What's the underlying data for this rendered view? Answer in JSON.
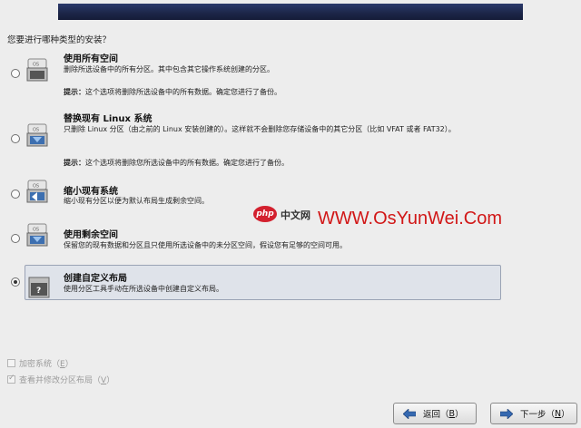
{
  "question": "您要进行哪种类型的安装？",
  "options": [
    {
      "title": "使用所有空间",
      "desc": "删除所选设备中的所有分区。其中包含其它操作系统创建的分区。",
      "note_label": "提示：",
      "note": "这个选项将删除所选设备中的所有数据。确定您进行了备份。",
      "icon": "disk-erase-icon",
      "selected": false
    },
    {
      "title": "替换现有 Linux 系统",
      "desc": "只删除 Linux 分区（由之前的 Linux 安装创建的）。这样就不会删除您存储设备中的其它分区（比如 VFAT 或者 FAT32）。",
      "note_label": "提示：",
      "note": "这个选项将删除您所选设备中的所有数据。确定您进行了备份。",
      "icon": "disk-replace-icon",
      "selected": false
    },
    {
      "title": "缩小现有系统",
      "desc": "缩小现有分区以便为默认布局生成剩余空间。",
      "icon": "disk-shrink-icon",
      "selected": false
    },
    {
      "title": "使用剩余空间",
      "desc": "保留您的现有数据和分区且只使用所选设备中的未分区空间，假设您有足够的空间可用。",
      "icon": "disk-free-space-icon",
      "selected": false
    },
    {
      "title": "创建自定义布局",
      "desc": "使用分区工具手动在所选设备中创建自定义布局。",
      "icon": "disk-custom-icon",
      "selected": true
    }
  ],
  "watermark": {
    "logo": "php",
    "cn": "中文网",
    "url": "WWW.OsYunWei.Com"
  },
  "checkboxes": [
    {
      "label": "加密系统",
      "mnemonic": "E",
      "checked": false
    },
    {
      "label": "查看并修改分区布局",
      "mnemonic": "V",
      "checked": true
    }
  ],
  "buttons": {
    "back_label": "返回",
    "back_mnemonic": "B",
    "next_label": "下一步",
    "next_mnemonic": "N"
  },
  "colors": {
    "banner": "#1c2547",
    "selected_bg": "#dfe3ea",
    "watermark_red": "#d11717"
  }
}
